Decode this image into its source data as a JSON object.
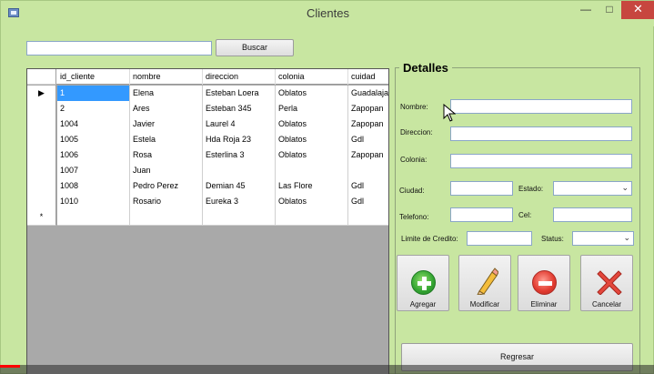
{
  "window": {
    "title": "Clientes",
    "minimize": "—",
    "maximize": "□",
    "close": "✕"
  },
  "search": {
    "value": "",
    "placeholder": "",
    "button": "Buscar"
  },
  "grid": {
    "columns": [
      "id_cliente",
      "nombre",
      "direccion",
      "colonia",
      "cuidad"
    ],
    "rows": [
      {
        "id_cliente": "1",
        "nombre": "Elena",
        "direccion": "Esteban Loera",
        "colonia": "Oblatos",
        "cuidad": "Guadalajar"
      },
      {
        "id_cliente": "2",
        "nombre": "Ares",
        "direccion": "Esteban 345",
        "colonia": "Perla",
        "cuidad": "Zapopan"
      },
      {
        "id_cliente": "1004",
        "nombre": "Javier",
        "direccion": "Laurel 4",
        "colonia": "Oblatos",
        "cuidad": "Zapopan"
      },
      {
        "id_cliente": "1005",
        "nombre": "Estela",
        "direccion": "Hda Roja 23",
        "colonia": "Oblatos",
        "cuidad": "Gdl"
      },
      {
        "id_cliente": "1006",
        "nombre": "Rosa",
        "direccion": "Esterlina 3",
        "colonia": "Oblatos",
        "cuidad": "Zapopan"
      },
      {
        "id_cliente": "1007",
        "nombre": "Juan",
        "direccion": "",
        "colonia": "",
        "cuidad": ""
      },
      {
        "id_cliente": "1008",
        "nombre": "Pedro Perez",
        "direccion": "Demian 45",
        "colonia": "Las Flore",
        "cuidad": "Gdl"
      },
      {
        "id_cliente": "1010",
        "nombre": "Rosario",
        "direccion": "Eureka 3",
        "colonia": "Oblatos",
        "cuidad": "Gdl"
      }
    ],
    "current_row_marker": "▶",
    "new_row_marker": "*"
  },
  "details": {
    "title": "Detalles",
    "labels": {
      "nombre": "Nombre:",
      "direccion": "Direccion:",
      "colonia": "Colonia:",
      "ciudad": "Ciudad:",
      "estado": "Estado:",
      "telefono": "Telefono:",
      "cel": "Cel:",
      "limite": "Limite de Credito:",
      "status": "Status:"
    },
    "values": {
      "nombre": "",
      "direccion": "",
      "colonia": "",
      "ciudad": "",
      "estado": "",
      "telefono": "",
      "cel": "",
      "limite": "",
      "status": ""
    }
  },
  "actions": {
    "agregar": "Agregar",
    "modificar": "Modificar",
    "eliminar": "Eliminar",
    "cancelar": "Cancelar",
    "regresar": "Regresar"
  },
  "video_progress": 0.03,
  "colors": {
    "window_bg": "#c8e6a1",
    "selected": "#3399ff",
    "close_button": "#c7463f"
  }
}
